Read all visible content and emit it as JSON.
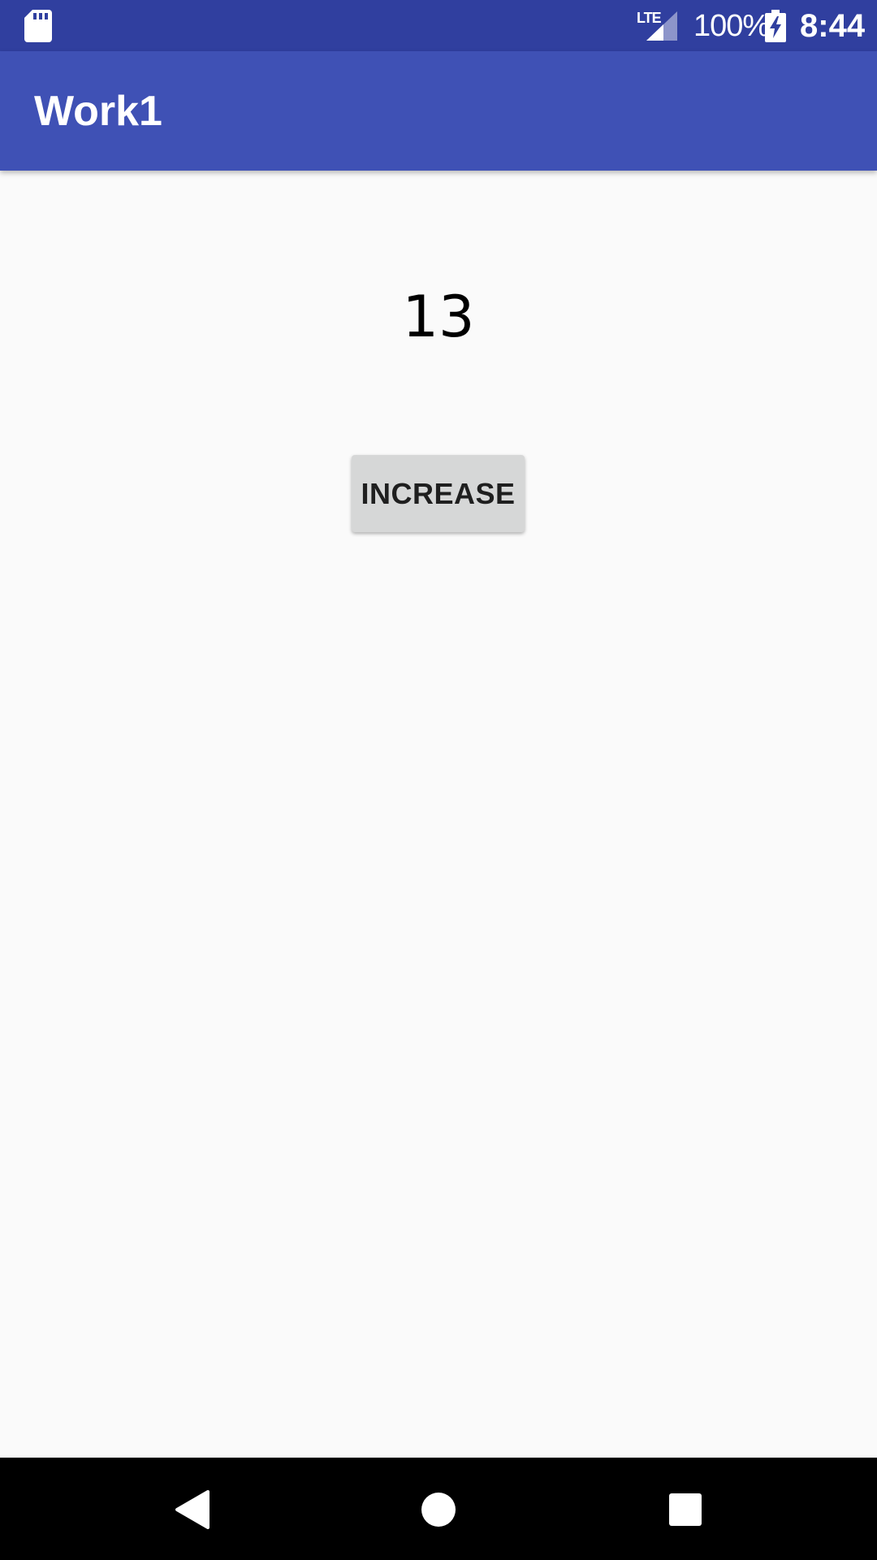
{
  "status_bar": {
    "network_label": "LTE",
    "battery_percent": "100%",
    "time": "8:44",
    "icons": [
      "sd-card-icon",
      "signal-icon",
      "battery-charging-icon"
    ]
  },
  "app_bar": {
    "title": "Work1",
    "color": "#3f51b5"
  },
  "main": {
    "counter_value": "13",
    "increase_button_label": "INCREASE"
  },
  "nav_bar": {
    "icons": [
      "back-icon",
      "home-icon",
      "recent-apps-icon"
    ]
  },
  "colors": {
    "status_bar": "#303f9f",
    "app_bar": "#3f51b5",
    "background": "#fafafa",
    "button": "#d6d7d7"
  }
}
